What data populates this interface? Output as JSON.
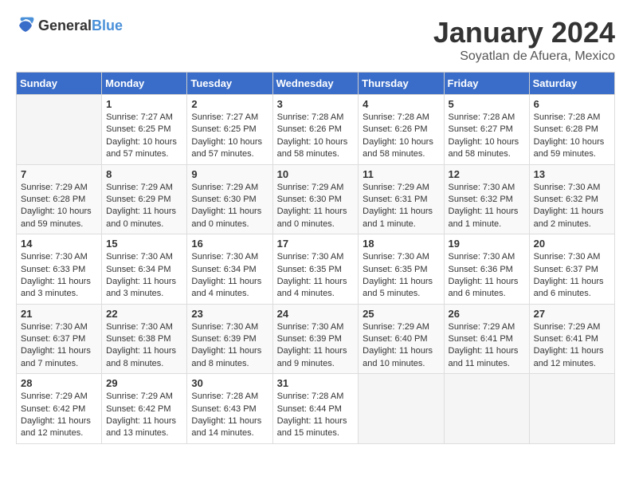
{
  "header": {
    "logo": {
      "general": "General",
      "blue": "Blue"
    },
    "title": "January 2024",
    "location": "Soyatlan de Afuera, Mexico"
  },
  "calendar": {
    "days_of_week": [
      "Sunday",
      "Monday",
      "Tuesday",
      "Wednesday",
      "Thursday",
      "Friday",
      "Saturday"
    ],
    "weeks": [
      [
        {
          "day": "",
          "info": ""
        },
        {
          "day": "1",
          "info": "Sunrise: 7:27 AM\nSunset: 6:25 PM\nDaylight: 10 hours\nand 57 minutes."
        },
        {
          "day": "2",
          "info": "Sunrise: 7:27 AM\nSunset: 6:25 PM\nDaylight: 10 hours\nand 57 minutes."
        },
        {
          "day": "3",
          "info": "Sunrise: 7:28 AM\nSunset: 6:26 PM\nDaylight: 10 hours\nand 58 minutes."
        },
        {
          "day": "4",
          "info": "Sunrise: 7:28 AM\nSunset: 6:26 PM\nDaylight: 10 hours\nand 58 minutes."
        },
        {
          "day": "5",
          "info": "Sunrise: 7:28 AM\nSunset: 6:27 PM\nDaylight: 10 hours\nand 58 minutes."
        },
        {
          "day": "6",
          "info": "Sunrise: 7:28 AM\nSunset: 6:28 PM\nDaylight: 10 hours\nand 59 minutes."
        }
      ],
      [
        {
          "day": "7",
          "info": "Sunrise: 7:29 AM\nSunset: 6:28 PM\nDaylight: 10 hours\nand 59 minutes."
        },
        {
          "day": "8",
          "info": "Sunrise: 7:29 AM\nSunset: 6:29 PM\nDaylight: 11 hours\nand 0 minutes."
        },
        {
          "day": "9",
          "info": "Sunrise: 7:29 AM\nSunset: 6:30 PM\nDaylight: 11 hours\nand 0 minutes."
        },
        {
          "day": "10",
          "info": "Sunrise: 7:29 AM\nSunset: 6:30 PM\nDaylight: 11 hours\nand 0 minutes."
        },
        {
          "day": "11",
          "info": "Sunrise: 7:29 AM\nSunset: 6:31 PM\nDaylight: 11 hours\nand 1 minute."
        },
        {
          "day": "12",
          "info": "Sunrise: 7:30 AM\nSunset: 6:32 PM\nDaylight: 11 hours\nand 1 minute."
        },
        {
          "day": "13",
          "info": "Sunrise: 7:30 AM\nSunset: 6:32 PM\nDaylight: 11 hours\nand 2 minutes."
        }
      ],
      [
        {
          "day": "14",
          "info": "Sunrise: 7:30 AM\nSunset: 6:33 PM\nDaylight: 11 hours\nand 3 minutes."
        },
        {
          "day": "15",
          "info": "Sunrise: 7:30 AM\nSunset: 6:34 PM\nDaylight: 11 hours\nand 3 minutes."
        },
        {
          "day": "16",
          "info": "Sunrise: 7:30 AM\nSunset: 6:34 PM\nDaylight: 11 hours\nand 4 minutes."
        },
        {
          "day": "17",
          "info": "Sunrise: 7:30 AM\nSunset: 6:35 PM\nDaylight: 11 hours\nand 4 minutes."
        },
        {
          "day": "18",
          "info": "Sunrise: 7:30 AM\nSunset: 6:35 PM\nDaylight: 11 hours\nand 5 minutes."
        },
        {
          "day": "19",
          "info": "Sunrise: 7:30 AM\nSunset: 6:36 PM\nDaylight: 11 hours\nand 6 minutes."
        },
        {
          "day": "20",
          "info": "Sunrise: 7:30 AM\nSunset: 6:37 PM\nDaylight: 11 hours\nand 6 minutes."
        }
      ],
      [
        {
          "day": "21",
          "info": "Sunrise: 7:30 AM\nSunset: 6:37 PM\nDaylight: 11 hours\nand 7 minutes."
        },
        {
          "day": "22",
          "info": "Sunrise: 7:30 AM\nSunset: 6:38 PM\nDaylight: 11 hours\nand 8 minutes."
        },
        {
          "day": "23",
          "info": "Sunrise: 7:30 AM\nSunset: 6:39 PM\nDaylight: 11 hours\nand 8 minutes."
        },
        {
          "day": "24",
          "info": "Sunrise: 7:30 AM\nSunset: 6:39 PM\nDaylight: 11 hours\nand 9 minutes."
        },
        {
          "day": "25",
          "info": "Sunrise: 7:29 AM\nSunset: 6:40 PM\nDaylight: 11 hours\nand 10 minutes."
        },
        {
          "day": "26",
          "info": "Sunrise: 7:29 AM\nSunset: 6:41 PM\nDaylight: 11 hours\nand 11 minutes."
        },
        {
          "day": "27",
          "info": "Sunrise: 7:29 AM\nSunset: 6:41 PM\nDaylight: 11 hours\nand 12 minutes."
        }
      ],
      [
        {
          "day": "28",
          "info": "Sunrise: 7:29 AM\nSunset: 6:42 PM\nDaylight: 11 hours\nand 12 minutes."
        },
        {
          "day": "29",
          "info": "Sunrise: 7:29 AM\nSunset: 6:42 PM\nDaylight: 11 hours\nand 13 minutes."
        },
        {
          "day": "30",
          "info": "Sunrise: 7:28 AM\nSunset: 6:43 PM\nDaylight: 11 hours\nand 14 minutes."
        },
        {
          "day": "31",
          "info": "Sunrise: 7:28 AM\nSunset: 6:44 PM\nDaylight: 11 hours\nand 15 minutes."
        },
        {
          "day": "",
          "info": ""
        },
        {
          "day": "",
          "info": ""
        },
        {
          "day": "",
          "info": ""
        }
      ]
    ]
  }
}
